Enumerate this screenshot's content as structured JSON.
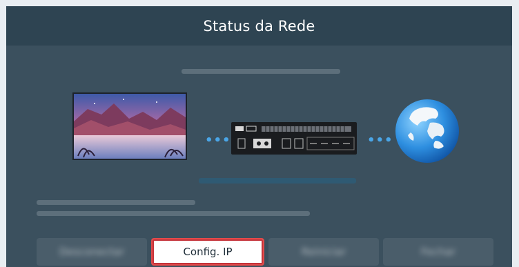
{
  "window": {
    "title": "Status da Rede"
  },
  "diagram": {
    "devices": [
      {
        "icon": "tv-icon"
      },
      {
        "icon": "connect-box-icon"
      },
      {
        "icon": "globe-icon"
      }
    ],
    "connector_glyph": "•••"
  },
  "buttons": [
    {
      "label": "Desconectar",
      "state": "blurred"
    },
    {
      "label": "Config. IP",
      "state": "focused"
    },
    {
      "label": "Reiniciar",
      "state": "blurred"
    },
    {
      "label": "Fechar",
      "state": "blurred"
    }
  ],
  "colors": {
    "title_bar": "#2e4452",
    "panel": "#3b505e",
    "accent_dots": "#4aa6e8",
    "focus_border": "#e24b4b"
  }
}
